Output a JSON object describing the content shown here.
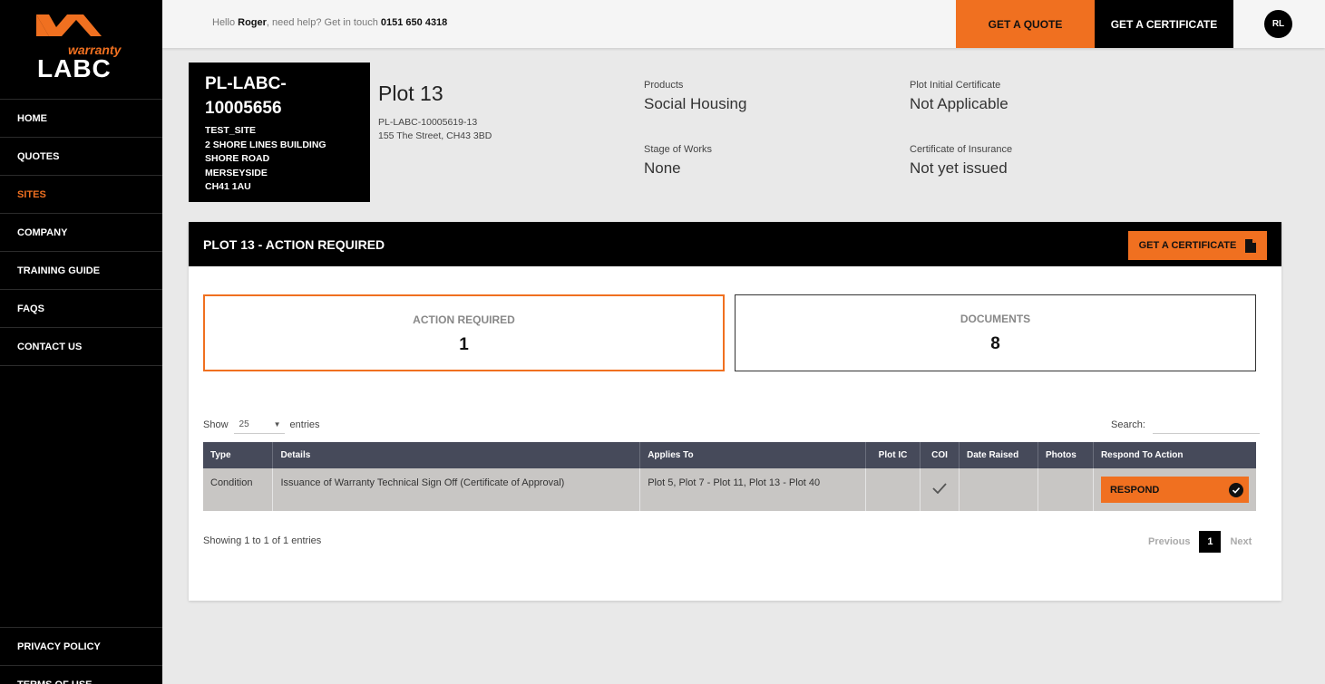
{
  "brand": {
    "logo_small": "warranty",
    "logo_large": "LABC",
    "accent": "#f07020"
  },
  "sidebar": {
    "items": [
      {
        "label": "HOME",
        "active": false
      },
      {
        "label": "QUOTES",
        "active": false
      },
      {
        "label": "SITES",
        "active": true
      },
      {
        "label": "COMPANY",
        "active": false
      },
      {
        "label": "TRAINING GUIDE",
        "active": false
      },
      {
        "label": "FAQS",
        "active": false
      },
      {
        "label": "CONTACT US",
        "active": false
      }
    ],
    "bottom_items": [
      {
        "label": "PRIVACY POLICY"
      },
      {
        "label": "TERMS OF USE"
      }
    ]
  },
  "topbar": {
    "greeting_prefix": "Hello ",
    "user_name": "Roger",
    "greeting_middle": ", need help? Get in touch ",
    "phone": "0151 650 4318",
    "quote_button": "GET A QUOTE",
    "certificate_button": "GET A CERTIFICATE",
    "avatar_initials": "RL"
  },
  "site": {
    "ref_line1": "PL-LABC-",
    "ref_line2": "10005656",
    "address": [
      "TEST_SITE",
      "2 SHORE LINES BUILDING",
      "SHORE ROAD",
      "MERSEYSIDE",
      "CH41 1AU"
    ]
  },
  "plot": {
    "title": "Plot 13",
    "ref": "PL-LABC-10005619-13",
    "address": "155 The Street, CH43 3BD",
    "products_label": "Products",
    "products_value": "Social Housing",
    "stage_label": "Stage of Works",
    "stage_value": "None",
    "initial_cert_label": "Plot Initial Certificate",
    "initial_cert_value": "Not Applicable",
    "coi_label": "Certificate of Insurance",
    "coi_value": "Not yet issued"
  },
  "panel": {
    "title": "PLOT 13 - ACTION REQUIRED",
    "certificate_button": "GET A CERTIFICATE",
    "stats": {
      "action_label": "ACTION REQUIRED",
      "action_value": "1",
      "documents_label": "DOCUMENTS",
      "documents_value": "8"
    },
    "show_label": "Show",
    "entries_label": "entries",
    "page_size": "25",
    "search_label": "Search:",
    "search_value": "",
    "table": {
      "headers": [
        "Type",
        "Details",
        "Applies To",
        "Plot IC",
        "COI",
        "Date Raised",
        "Photos",
        "Respond To Action"
      ],
      "rows": [
        {
          "type": "Condition",
          "details": "Issuance of Warranty Technical Sign Off (Certificate of Approval)",
          "applies_to": "Plot 5, Plot 7 - Plot 11, Plot 13 - Plot 40",
          "plot_ic": "",
          "coi_checked": true,
          "date_raised": "",
          "photos": "",
          "respond_label": "RESPOND"
        }
      ]
    },
    "showing_text": "Showing 1 to 1 of 1 entries",
    "pagination": {
      "previous": "Previous",
      "current": "1",
      "next": "Next"
    }
  }
}
